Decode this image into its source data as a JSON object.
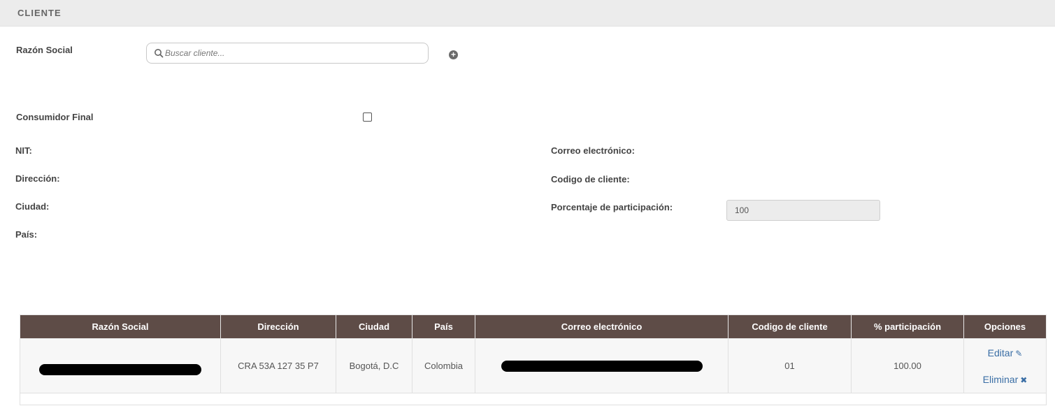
{
  "section": {
    "title": "CLIENTE"
  },
  "form": {
    "razon_social_label": "Razón Social",
    "search_placeholder": "Buscar cliente...",
    "consumidor_final_label": "Consumidor Final",
    "consumidor_final_checked": false,
    "nit_label": "NIT:",
    "direccion_label": "Dirección:",
    "ciudad_label": "Ciudad:",
    "pais_label": "País:",
    "correo_label": "Correo electrónico:",
    "codigo_label": "Codigo de cliente:",
    "porcentaje_label": "Porcentaje de participación:",
    "porcentaje_value": "100"
  },
  "table": {
    "headers": [
      "Razón Social",
      "Dirección",
      "Ciudad",
      "País",
      "Correo electrónico",
      "Codigo de cliente",
      "% participación",
      "Opciones"
    ],
    "rows": [
      {
        "direccion": "CRA 53A 127 35 P7",
        "ciudad": "Bogotá, D.C",
        "pais": "Colombia",
        "codigo": "01",
        "participacion": "100.00",
        "editar": "Editar",
        "eliminar": "Eliminar"
      }
    ]
  },
  "colors": {
    "header_bg": "#5e4c47",
    "link": "#3a6ea5",
    "section_bg": "#ececec"
  },
  "icons": {
    "search": "search-icon",
    "add": "plus-circle-icon",
    "edit": "edit-icon",
    "delete": "close-icon"
  }
}
